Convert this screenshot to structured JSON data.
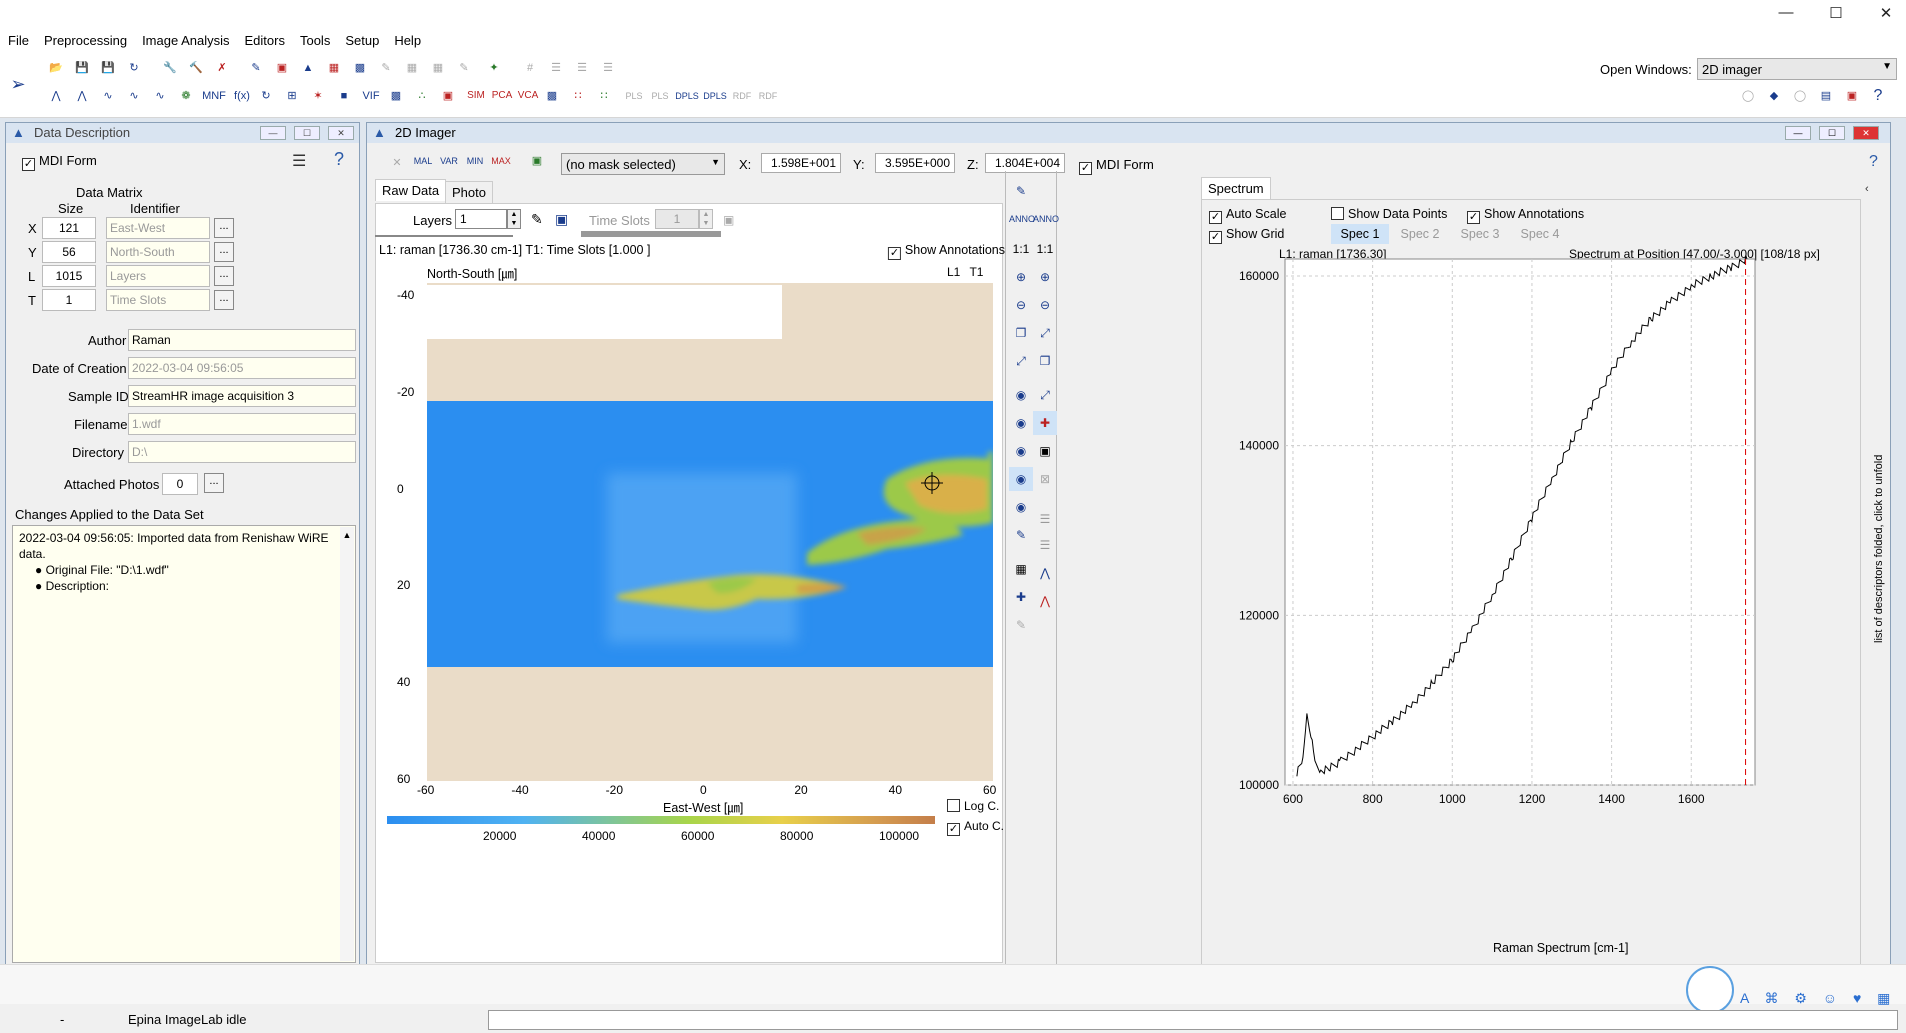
{
  "menu": [
    "File",
    "Preprocessing",
    "Image Analysis",
    "Editors",
    "Tools",
    "Setup",
    "Help"
  ],
  "open_windows": {
    "label": "Open Windows:",
    "value": "2D imager"
  },
  "data_desc": {
    "title": "Data Description",
    "mdi_form": "MDI Form",
    "matrix_title": "Data Matrix",
    "col_size": "Size",
    "col_identifier": "Identifier",
    "rows": [
      {
        "axis": "X",
        "size": "121",
        "id": "East-West"
      },
      {
        "axis": "Y",
        "size": "56",
        "id": "North-South"
      },
      {
        "axis": "L",
        "size": "1015",
        "id": "Layers"
      },
      {
        "axis": "T",
        "size": "1",
        "id": "Time Slots"
      }
    ],
    "author_label": "Author",
    "author": "Raman",
    "date_label": "Date of Creation",
    "date": "2022-03-04 09:56:05",
    "sample_label": "Sample ID",
    "sample": "StreamHR image acquisition 3",
    "filename_label": "Filename",
    "filename": "1.wdf",
    "directory_label": "Directory",
    "directory": "D:\\",
    "photos_label": "Attached Photos",
    "photos": "0",
    "changes_label": "Changes Applied to the Data Set",
    "log_line1": "2022-03-04 09:56:05: Imported data from Renishaw WiRE data.",
    "log_item1": "Original File: \"D:\\1.wdf\"",
    "log_item2": "Description:",
    "ellipsis": "..."
  },
  "imager": {
    "title": "2D Imager",
    "mask": "(no mask selected)",
    "x_label": "X:",
    "x_val": "1.598E+001",
    "y_label": "Y:",
    "y_val": "3.595E+000",
    "z_label": "Z:",
    "z_val": "1.804E+004",
    "mdi_form": "MDI Form",
    "tab_raw": "Raw Data",
    "tab_photo": "Photo",
    "layers_label": "Layers",
    "layers_val": "1",
    "timeslots_label": "Time Slots",
    "timeslots_val": "1",
    "info": "L1: raman [1736.30 cm-1]  T1: Time Slots [1.000 ]",
    "show_annotations": "Show Annotations",
    "yaxis_title": "North-South [㎛]",
    "corner": "L1  T1",
    "xaxis_title": "East-West [㎛]",
    "xticks": [
      "-60",
      "-40",
      "-20",
      "0",
      "20",
      "40",
      "60"
    ],
    "yticks": [
      "-40",
      "-20",
      "0",
      "20",
      "40",
      "60"
    ],
    "colorbar_ticks": [
      "20000",
      "40000",
      "60000",
      "80000",
      "100000"
    ],
    "log_c": "Log C.",
    "auto_c": "Auto C.",
    "ratio_a": "1:1",
    "ratio_b": "1:1"
  },
  "spectrum": {
    "tab": "Spectrum",
    "auto_scale": "Auto Scale",
    "show_data_points": "Show Data Points",
    "show_annotations": "Show Annotations",
    "show_grid": "Show Grid",
    "specs": [
      "Spec 1",
      "Spec 2",
      "Spec 3",
      "Spec 4"
    ],
    "header_left": "L1: raman [1736.30]",
    "header_right": "Spectrum at Position [47.00/-3.000] [108/18 px]",
    "side_note": "list of descriptors folded, click to unfold",
    "xaxis_title": "Raman Spectrum [cm-1]"
  },
  "chart_data": {
    "type": "line",
    "title": "Spectrum at Position [47.00/-3.000] [108/18 px]",
    "xlabel": "Raman Spectrum [cm-1]",
    "ylabel": "",
    "xlim": [
      580,
      1760
    ],
    "ylim": [
      100000,
      162000
    ],
    "xticks": [
      600,
      800,
      1000,
      1200,
      1400,
      1600
    ],
    "yticks": [
      100000,
      120000,
      140000,
      160000
    ],
    "grid": true,
    "marker_x": 1736.3,
    "series": [
      {
        "x": [
          610,
          625,
          635,
          645,
          655,
          670,
          690,
          720,
          760,
          800,
          850,
          900,
          950,
          1000,
          1050,
          1100,
          1150,
          1200,
          1250,
          1300,
          1350,
          1400,
          1450,
          1500,
          1550,
          1600,
          1650,
          1700,
          1740
        ],
        "y": [
          101500,
          103000,
          108500,
          106000,
          102500,
          101700,
          102000,
          102800,
          104200,
          105700,
          107500,
          109500,
          112000,
          114800,
          118300,
          122300,
          126700,
          131500,
          136000,
          140500,
          144600,
          148800,
          152300,
          155000,
          157000,
          158800,
          160000,
          161000,
          162000
        ]
      }
    ]
  },
  "status": {
    "left": "-",
    "app": "Epina ImageLab idle"
  }
}
